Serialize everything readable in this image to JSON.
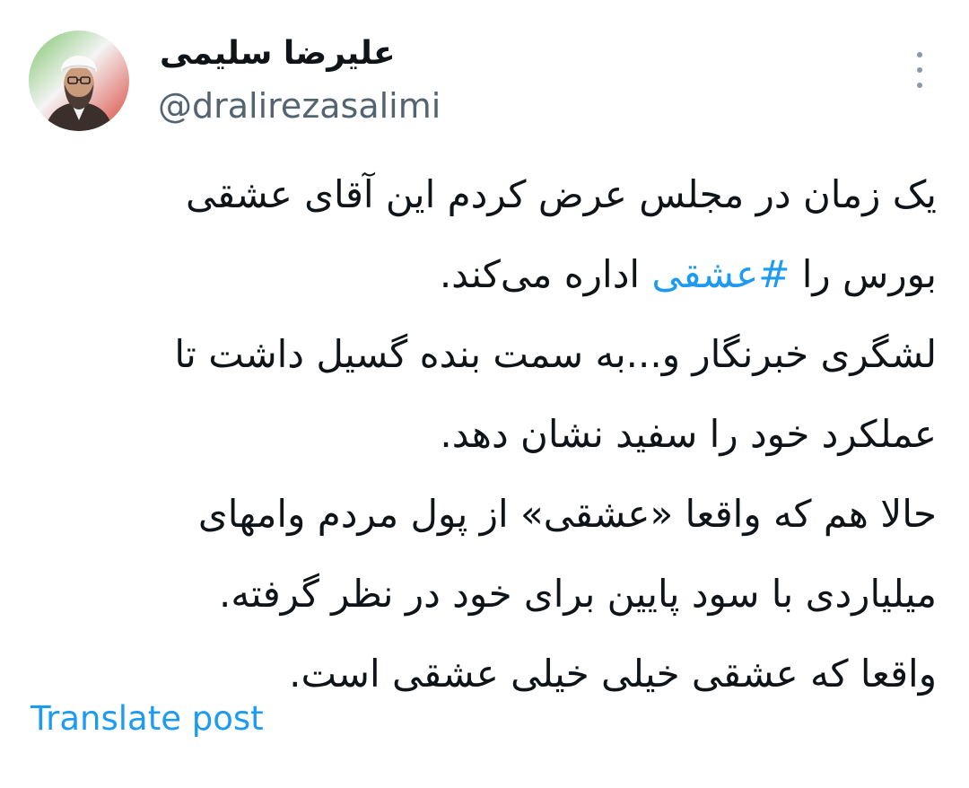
{
  "author": {
    "display_name": "علیرضا سلیمی",
    "handle": "@dralirezasalimi"
  },
  "tweet": {
    "line_1": "یک زمان در مجلس عرض کردم این آقای عشقی",
    "line_2_before": "بورس را ",
    "line_2_hashtag": "#عشقی",
    "line_2_after": " اداره می‌کند.",
    "line_3": "لشگری خبرنگار و...به سمت بنده گسیل داشت تا",
    "line_4": "عملکرد خود را سفید نشان دهد.",
    "line_5": "حالا هم که واقعا «عشقی» از پول مردم وامهای",
    "line_6": "میلیاردی با سود پایین برای خود در نظر گرفته.",
    "line_7": "واقعا که عشقی خیلی خیلی عشقی است."
  },
  "actions": {
    "translate_label": "Translate post",
    "more_icon": "more-vertical-icon"
  },
  "colors": {
    "link": "#1d9bf0",
    "secondary_text": "#536471",
    "primary_text": "#0f1419"
  }
}
